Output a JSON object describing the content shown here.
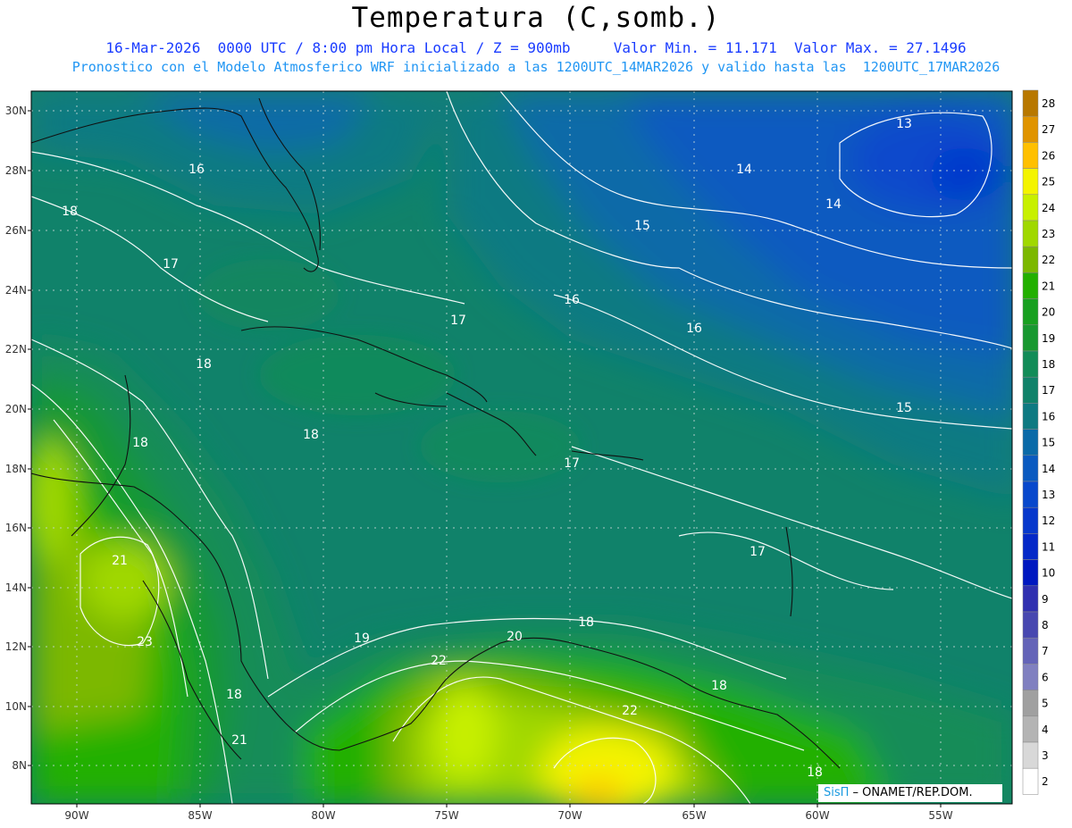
{
  "header": {
    "title": "Temperatura (C,somb.)",
    "subtitle_line1": "16-Mar-2026  0000 UTC / 8:00 pm Hora Local / Z = 900mb     Valor Min. = 11.171  Valor Max. = 27.1496",
    "subtitle_line2": "Pronostico con el Modelo Atmosferico WRF inicializado a las 1200UTC_14MAR2026 y valido hasta las  1200UTC_17MAR2026"
  },
  "axes": {
    "lat_labels": [
      "30N",
      "28N",
      "26N",
      "24N",
      "22N",
      "20N",
      "18N",
      "16N",
      "14N",
      "12N",
      "10N",
      "8N"
    ],
    "lon_labels": [
      "90W",
      "85W",
      "80W",
      "75W",
      "70W",
      "65W",
      "60W",
      "55W"
    ]
  },
  "colorbar": {
    "labels": [
      "28",
      "27",
      "26",
      "25",
      "24",
      "23",
      "22",
      "21",
      "20",
      "19",
      "18",
      "17",
      "16",
      "15",
      "14",
      "13",
      "12",
      "11",
      "10",
      "9",
      "8",
      "7",
      "6",
      "5",
      "4",
      "3",
      "2"
    ],
    "colors": [
      "#b87800",
      "#e09400",
      "#ffc000",
      "#f4f400",
      "#c8f000",
      "#a0d800",
      "#7cb800",
      "#22b000",
      "#18a020",
      "#189830",
      "#128c58",
      "#10826a",
      "#0e7a82",
      "#0a6aa8",
      "#0a5ac0",
      "#0848cc",
      "#0638cc",
      "#0428c8",
      "#0018c0",
      "#3030b0",
      "#4848b0",
      "#6464b8",
      "#8080c0",
      "#a0a0a0",
      "#b4b4b4",
      "#d8d8d8",
      "#ffffff"
    ]
  },
  "contour_labels": [
    {
      "text": "13"
    },
    {
      "text": "14"
    },
    {
      "text": "14"
    },
    {
      "text": "15"
    },
    {
      "text": "15"
    },
    {
      "text": "16"
    },
    {
      "text": "16"
    },
    {
      "text": "16"
    },
    {
      "text": "17"
    },
    {
      "text": "17"
    },
    {
      "text": "17"
    },
    {
      "text": "17"
    },
    {
      "text": "18"
    },
    {
      "text": "18"
    },
    {
      "text": "18"
    },
    {
      "text": "18"
    },
    {
      "text": "18"
    },
    {
      "text": "18"
    },
    {
      "text": "18"
    },
    {
      "text": "18"
    },
    {
      "text": "19"
    },
    {
      "text": "20"
    },
    {
      "text": "21"
    },
    {
      "text": "21"
    },
    {
      "text": "22"
    },
    {
      "text": "22"
    },
    {
      "text": "23"
    }
  ],
  "credit": {
    "brand": "SisΠ",
    "text": " – ONAMET/REP.DOM."
  }
}
